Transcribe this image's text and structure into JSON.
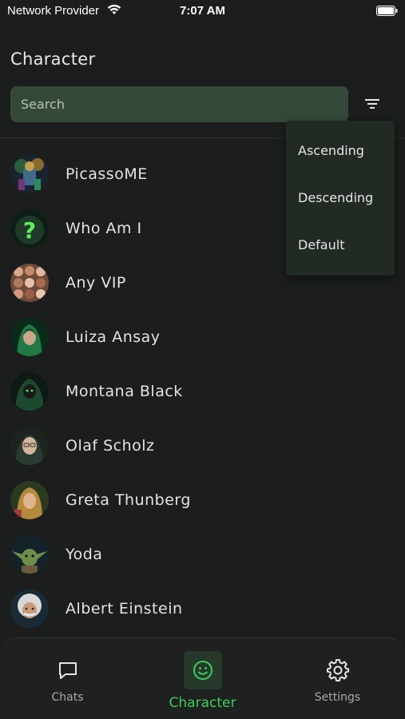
{
  "status_bar": {
    "carrier": "Network Provider",
    "time": "7:07 AM"
  },
  "header": {
    "title": "Character"
  },
  "search": {
    "placeholder": "Search"
  },
  "sort_menu": {
    "options": [
      "Ascending",
      "Descending",
      "Default"
    ]
  },
  "characters": [
    {
      "name": "PicassoME"
    },
    {
      "name": "Who Am I"
    },
    {
      "name": "Any VIP"
    },
    {
      "name": "Luiza Ansay"
    },
    {
      "name": "Montana Black"
    },
    {
      "name": "Olaf Scholz"
    },
    {
      "name": "Greta Thunberg"
    },
    {
      "name": "Yoda"
    },
    {
      "name": "Albert Einstein"
    }
  ],
  "bottom_nav": {
    "items": [
      {
        "label": "Chats",
        "icon": "chat-bubble-icon"
      },
      {
        "label": "Character",
        "icon": "smiley-icon",
        "active": true
      },
      {
        "label": "Settings",
        "icon": "gear-icon"
      }
    ]
  },
  "colors": {
    "accent": "#3ccf5c",
    "background": "#1b1e1c",
    "search_bg": "#35493a"
  }
}
